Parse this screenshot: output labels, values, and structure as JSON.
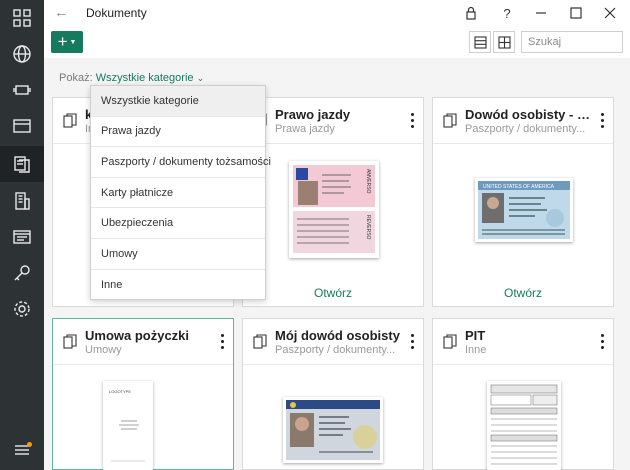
{
  "window": {
    "title": "Dokumenty"
  },
  "toolbar": {
    "add_label": "+",
    "search_placeholder": "Szukaj"
  },
  "filter": {
    "label": "Pokaż:",
    "value": "Wszystkie kategorie"
  },
  "dropdown": {
    "items": [
      "Wszystkie kategorie",
      "Prawa jazdy",
      "Paszporty / dokumenty tożsamości",
      "Karty płatnicze",
      "Ubezpieczenia",
      "Umowy",
      "Inne"
    ]
  },
  "cards": [
    {
      "title": "k",
      "subtitle": "In"
    },
    {
      "title": "Prawo jazdy",
      "subtitle": "Prawa jazdy",
      "open": "Otwórz"
    },
    {
      "title": "Dowód osobisty - J...",
      "subtitle": "Paszporty / dokumenty...",
      "open": "Otwórz"
    },
    {
      "title": "Umowa pożyczki",
      "subtitle": "Umowy"
    },
    {
      "title": "Mój dowód osobisty",
      "subtitle": "Paszporty / dokumenty..."
    },
    {
      "title": "PIT",
      "subtitle": "Inne"
    }
  ],
  "thumbnails": {
    "license_text": [
      "ANVERSO",
      "REVERSO"
    ],
    "passport_text": "UNITED STATES OF AMERICA",
    "contract_text": "LOGOTYPE"
  }
}
